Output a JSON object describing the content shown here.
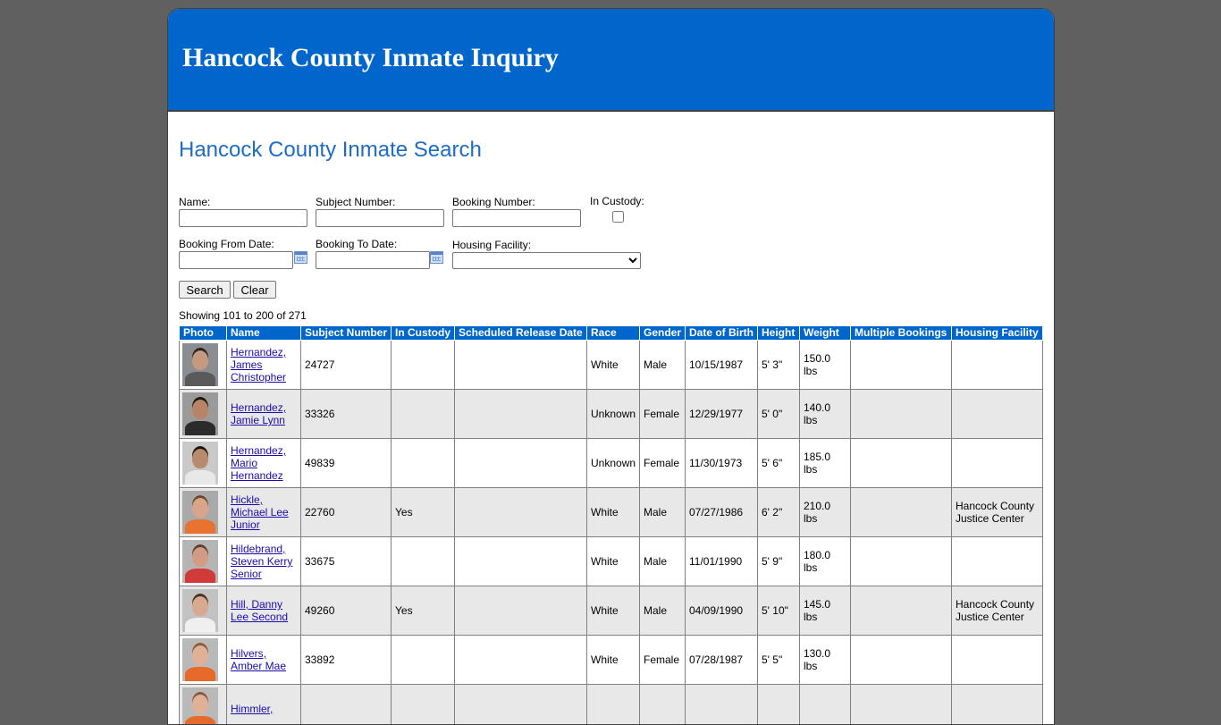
{
  "header": {
    "title": "Hancock County Inmate Inquiry"
  },
  "search": {
    "title": "Hancock County Inmate Search",
    "name_label": "Name:",
    "subject_label": "Subject Number:",
    "booking_label": "Booking Number:",
    "custody_label": "In Custody:",
    "from_label": "Booking From Date:",
    "to_label": "Booking To Date:",
    "facility_label": "Housing Facility:",
    "name_value": "",
    "subject_value": "",
    "booking_value": "",
    "from_value": "",
    "to_value": "",
    "facility_value": "",
    "search_button": "Search",
    "clear_button": "Clear"
  },
  "results": {
    "showing": "Showing 101 to 200 of 271",
    "columns": [
      "Photo",
      "Name",
      "Subject Number",
      "In Custody",
      "Scheduled Release Date",
      "Race",
      "Gender",
      "Date of Birth",
      "Height",
      "Weight",
      "Multiple Bookings",
      "Housing Facility"
    ],
    "rows": [
      {
        "name": "Hernandez, James Christopher",
        "subject": "24727",
        "custody": "",
        "release": "",
        "race": "White",
        "gender": "Male",
        "dob": "10/15/1987",
        "height": "5' 3\"",
        "weight": "150.0 lbs",
        "multiple": "",
        "facility": ""
      },
      {
        "name": "Hernandez, Jamie Lynn",
        "subject": "33326",
        "custody": "",
        "release": "",
        "race": "Unknown",
        "gender": "Female",
        "dob": "12/29/1977",
        "height": "5' 0\"",
        "weight": "140.0 lbs",
        "multiple": "",
        "facility": ""
      },
      {
        "name": "Hernandez, Mario Hernandez",
        "subject": "49839",
        "custody": "",
        "release": "",
        "race": "Unknown",
        "gender": "Female",
        "dob": "11/30/1973",
        "height": "5' 6\"",
        "weight": "185.0 lbs",
        "multiple": "",
        "facility": ""
      },
      {
        "name": "Hickle, Michael Lee Junior",
        "subject": "22760",
        "custody": "Yes",
        "release": "",
        "race": "White",
        "gender": "Male",
        "dob": "07/27/1986",
        "height": "6' 2\"",
        "weight": "210.0 lbs",
        "multiple": "",
        "facility": "Hancock County Justice Center"
      },
      {
        "name": "Hildebrand, Steven Kerry Senior",
        "subject": "33675",
        "custody": "",
        "release": "",
        "race": "White",
        "gender": "Male",
        "dob": "11/01/1990",
        "height": "5' 9\"",
        "weight": "180.0 lbs",
        "multiple": "",
        "facility": ""
      },
      {
        "name": "Hill, Danny Lee Second",
        "subject": "49260",
        "custody": "Yes",
        "release": "",
        "race": "White",
        "gender": "Male",
        "dob": "04/09/1990",
        "height": "5' 10\"",
        "weight": "145.0 lbs",
        "multiple": "",
        "facility": "Hancock County Justice Center"
      },
      {
        "name": "Hilvers, Amber Mae",
        "subject": "33892",
        "custody": "",
        "release": "",
        "race": "White",
        "gender": "Female",
        "dob": "07/28/1987",
        "height": "5' 5\"",
        "weight": "130.0 lbs",
        "multiple": "",
        "facility": ""
      },
      {
        "name": "Himmler,",
        "subject": "",
        "custody": "",
        "release": "",
        "race": "",
        "gender": "",
        "dob": "",
        "height": "",
        "weight": "",
        "multiple": "",
        "facility": ""
      }
    ]
  },
  "colors": {
    "banner": "#0066cc",
    "search_title": "#1e6cc4",
    "link": "#1a0dab",
    "alt_row": "#e8e8e8",
    "backdrop": "#606060"
  }
}
